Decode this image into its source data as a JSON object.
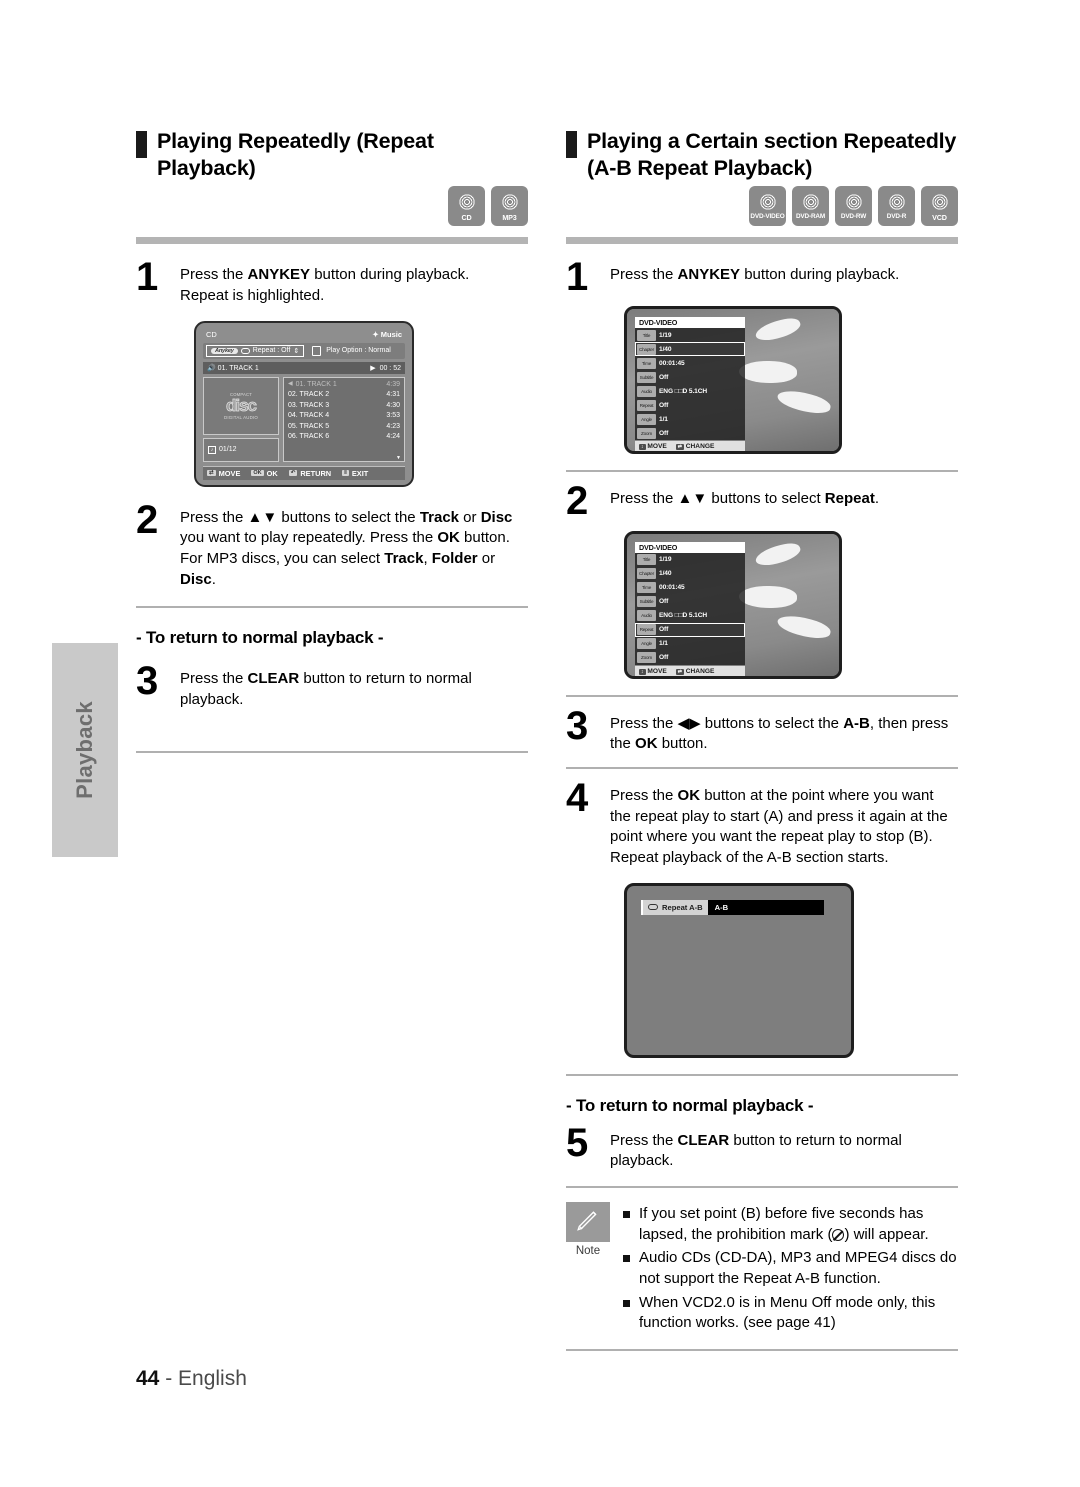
{
  "page": {
    "number": "44",
    "language": "English",
    "side_tab": "Playback"
  },
  "left_column": {
    "heading": "Playing Repeatedly (Repeat Playback)",
    "badges": [
      {
        "label": "CD",
        "icon": "disc-icon"
      },
      {
        "label": "MP3",
        "icon": "disc-icon"
      }
    ],
    "steps": [
      {
        "number": "1",
        "text_html": "Press the <b>ANYKEY</b> button during playback.<br>Repeat is highlighted."
      },
      {
        "number": "2",
        "text_html": "Press the ▲▼ buttons to select the <b>Track</b> or <b>Disc</b> you want to play repeatedly. Press the <b>OK</b> button. For MP3 discs, you can select <b>Track</b>, <b>Folder</b> or <b>Disc</b>."
      },
      {
        "number": "3",
        "text_html": "Press the <b>CLEAR</b> button to return to normal playback."
      }
    ],
    "subhead": "- To return to normal playback -",
    "cd_screen": {
      "source": "CD",
      "mode": "Music",
      "anykey_pill": "Anykey",
      "repeat_option": "Repeat : Off",
      "play_option": "Play Option : Normal",
      "now_playing": "01. TRACK 1",
      "now_playing_time": "00 : 52",
      "disc_logo_top": "COMPACT",
      "disc_logo": "disc",
      "disc_logo_sub": "DIGITAL AUDIO",
      "track_count": "01/12",
      "tracks": [
        {
          "name": "01. TRACK 1",
          "time": "4:39",
          "current": true
        },
        {
          "name": "02. TRACK 2",
          "time": "4:31",
          "current": false
        },
        {
          "name": "03. TRACK 3",
          "time": "4:30",
          "current": false
        },
        {
          "name": "04. TRACK 4",
          "time": "3:53",
          "current": false
        },
        {
          "name": "05. TRACK 5",
          "time": "4:23",
          "current": false
        },
        {
          "name": "06. TRACK 6",
          "time": "4:24",
          "current": false
        }
      ],
      "footer": [
        {
          "key": "⇄",
          "label": "MOVE"
        },
        {
          "key": "OK",
          "label": "OK"
        },
        {
          "key": "↶",
          "label": "RETURN"
        },
        {
          "key": "‖",
          "label": "EXIT"
        }
      ]
    }
  },
  "right_column": {
    "heading": "Playing a Certain section Repeatedly (A-B Repeat Playback)",
    "badges": [
      {
        "label": "DVD-VIDEO",
        "icon": "disc-icon"
      },
      {
        "label": "DVD-RAM",
        "icon": "disc-icon"
      },
      {
        "label": "DVD-RW",
        "icon": "disc-icon"
      },
      {
        "label": "DVD-R",
        "icon": "disc-icon"
      },
      {
        "label": "VCD",
        "icon": "disc-icon"
      }
    ],
    "steps": [
      {
        "number": "1",
        "text_html": "Press the <b>ANYKEY</b> button during playback."
      },
      {
        "number": "2",
        "text_html": "Press the ▲▼ buttons to select <b>Repeat</b>."
      },
      {
        "number": "3",
        "text_html": "Press the ◀▶ buttons to select the <b>A-B</b>, then press the <b>OK</b> button."
      },
      {
        "number": "4",
        "text_html": "Press the <b>OK</b> button at the point where you want the repeat play to start (A) and press it again at the point where you want the repeat play to stop (B). Repeat playback of the A-B section starts."
      },
      {
        "number": "5",
        "text_html": "Press the <b>CLEAR</b> button to return to normal playback."
      }
    ],
    "subhead": "- To return to normal playback -",
    "dvd_screen_1": {
      "title": "DVD-VIDEO",
      "rows": [
        {
          "icon": "Title",
          "label": "Title",
          "value": "1/19",
          "selected": false
        },
        {
          "icon": "Chapter",
          "label": "Chapter",
          "value": "1/40",
          "selected": true
        },
        {
          "icon": "Time",
          "label": "Time",
          "value": "00:01:45",
          "selected": false
        },
        {
          "icon": "Subtitle",
          "label": "Subtitle",
          "value": "Off",
          "selected": false
        },
        {
          "icon": "Audio",
          "label": "Audio",
          "value": "ENG □□D 5.1CH",
          "selected": false
        },
        {
          "icon": "Repeat",
          "label": "Repeat",
          "value": "Off",
          "selected": false
        },
        {
          "icon": "Angle",
          "label": "Angle",
          "value": "1/1",
          "selected": false
        },
        {
          "icon": "Zoom",
          "label": "Zoom",
          "value": "Off",
          "selected": false
        }
      ],
      "footer": [
        {
          "key": "↕",
          "label": "MOVE"
        },
        {
          "key": "⇄",
          "label": "CHANGE"
        }
      ]
    },
    "dvd_screen_2": {
      "title": "DVD-VIDEO",
      "rows": [
        {
          "icon": "Title",
          "label": "Title",
          "value": "1/19",
          "selected": false
        },
        {
          "icon": "Chapter",
          "label": "Chapter",
          "value": "1/40",
          "selected": false
        },
        {
          "icon": "Time",
          "label": "Time",
          "value": "00:01:45",
          "selected": false
        },
        {
          "icon": "Subtitle",
          "label": "Subtitle",
          "value": "Off",
          "selected": false
        },
        {
          "icon": "Audio",
          "label": "Audio",
          "value": "ENG □□D 5.1CH",
          "selected": false
        },
        {
          "icon": "Repeat",
          "label": "Repeat",
          "value": "Off",
          "selected": true
        },
        {
          "icon": "Angle",
          "label": "Angle",
          "value": "1/1",
          "selected": false
        },
        {
          "icon": "Zoom",
          "label": "Zoom",
          "value": "Off",
          "selected": false
        }
      ],
      "footer": [
        {
          "key": "↕",
          "label": "MOVE"
        },
        {
          "key": "⇄",
          "label": "CHANGE"
        }
      ]
    },
    "ab_screen": {
      "left_label": "Repeat  A-B",
      "right_label": "A-B"
    },
    "note": {
      "caption": "Note",
      "items_html": [
        "If you set point (B) before five seconds has lapsed, the prohibition mark (<span class=\"nb-circle\"></span>) will appear.",
        "Audio CDs (CD-DA), MP3 and MPEG4 discs do not support the Repeat A-B function.",
        "When VCD2.0 is in Menu Off mode only, this function works. (see page 41)"
      ]
    }
  }
}
